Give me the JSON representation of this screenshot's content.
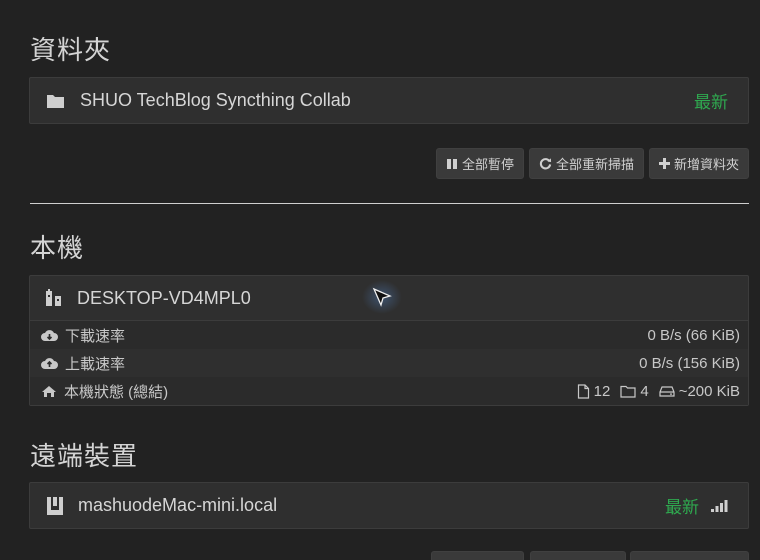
{
  "folders": {
    "section_title": "資料夾",
    "items": [
      {
        "icon": "folder-icon",
        "name": "SHUO TechBlog Syncthing Collab",
        "status": "最新",
        "status_color": "#2fa84f"
      }
    ],
    "actions": {
      "pause_all": "全部暫停",
      "rescan_all": "全部重新掃描",
      "add_folder": "新增資料夾"
    }
  },
  "this_device": {
    "section_title": "本機",
    "name": "DESKTOP-VD4MPL0",
    "icon": "qrcode-icon",
    "stats": {
      "download": {
        "label": "下載速率",
        "value": "0 B/s (66 KiB)",
        "icon": "cloud-download-icon"
      },
      "upload": {
        "label": "上載速率",
        "value": "0 B/s (156 KiB)",
        "icon": "cloud-upload-icon"
      },
      "state": {
        "label": "本機狀態 (總結)",
        "icon": "home-icon",
        "files": "12",
        "folders": "4",
        "size": "~200 KiB"
      }
    }
  },
  "remote_devices": {
    "section_title": "遠端裝置",
    "items": [
      {
        "icon": "device-icon",
        "name": "mashuodeMac-mini.local",
        "status": "最新",
        "status_color": "#2fa84f",
        "signal_icon": "signal-icon"
      }
    ]
  }
}
